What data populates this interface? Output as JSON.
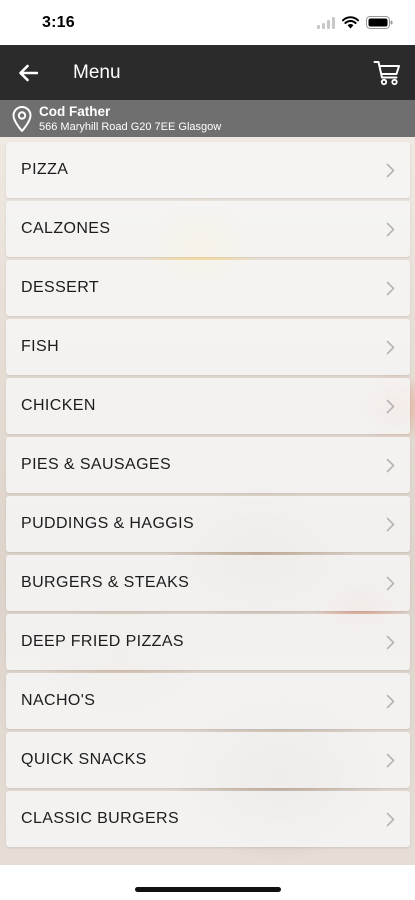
{
  "status_bar": {
    "time": "3:16"
  },
  "nav": {
    "title": "Menu",
    "back_icon": "arrow-left-icon",
    "cart_icon": "cart-icon"
  },
  "store": {
    "name": "Cod Father",
    "address": "566 Maryhill Road G20 7EE Glasgow",
    "icon": "location-pin-icon"
  },
  "menu": {
    "items": [
      {
        "label": "PIZZA"
      },
      {
        "label": "CALZONES"
      },
      {
        "label": "DESSERT"
      },
      {
        "label": "FISH"
      },
      {
        "label": "CHICKEN"
      },
      {
        "label": "PIES & SAUSAGES"
      },
      {
        "label": "PUDDINGS & HAGGIS"
      },
      {
        "label": "BURGERS & STEAKS"
      },
      {
        "label": "DEEP FRIED PIZZAS"
      },
      {
        "label": "NACHO'S"
      },
      {
        "label": "QUICK SNACKS"
      },
      {
        "label": "CLASSIC BURGERS"
      }
    ]
  },
  "colors": {
    "nav_bg": "#2b2b2b",
    "store_bar_bg": "#6f6f6f",
    "row_bg": "#f6f6f6",
    "text": "#1c1c1c"
  }
}
